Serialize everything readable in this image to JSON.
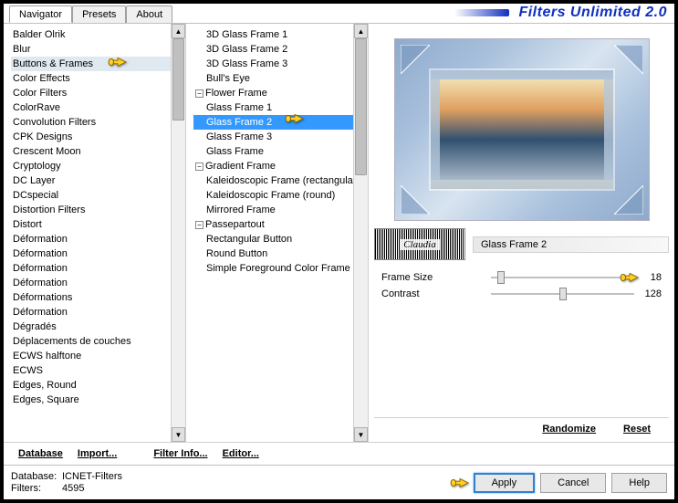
{
  "app_title": "Filters Unlimited 2.0",
  "tabs": [
    "Navigator",
    "Presets",
    "About"
  ],
  "active_tab": 0,
  "categories": [
    "Balder Olrik",
    "Blur",
    "Buttons & Frames",
    "Color Effects",
    "Color Filters",
    "ColorRave",
    "Convolution Filters",
    "CPK Designs",
    "Crescent Moon",
    "Cryptology",
    "DC Layer",
    "DCspecial",
    "Distortion Filters",
    "Distort",
    "Déformation",
    "Déformation",
    "Déformation",
    "Déformation",
    "Déformations",
    "Déformation",
    "Dégradés",
    "Déplacements de couches",
    "ECWS halftone",
    "ECWS",
    "Edges, Round",
    "Edges, Square"
  ],
  "category_highlight_index": 2,
  "filters": [
    {
      "label": "3D Glass Frame 1",
      "exp": false
    },
    {
      "label": "3D Glass Frame 2",
      "exp": false
    },
    {
      "label": "3D Glass Frame 3",
      "exp": false
    },
    {
      "label": "Bull's Eye",
      "exp": false
    },
    {
      "label": "Flower Frame",
      "exp": true
    },
    {
      "label": "Glass Frame 1",
      "exp": false
    },
    {
      "label": "Glass Frame 2",
      "exp": false,
      "selected": true
    },
    {
      "label": "Glass Frame 3",
      "exp": false
    },
    {
      "label": "Glass Frame",
      "exp": false
    },
    {
      "label": "Gradient Frame",
      "exp": true
    },
    {
      "label": "Kaleidoscopic Frame (rectangular)",
      "exp": false
    },
    {
      "label": "Kaleidoscopic Frame (round)",
      "exp": false
    },
    {
      "label": "Mirrored Frame",
      "exp": false
    },
    {
      "label": "Passepartout",
      "exp": true
    },
    {
      "label": "Rectangular Button",
      "exp": false
    },
    {
      "label": "Round Button",
      "exp": false
    },
    {
      "label": "Simple Foreground Color Frame",
      "exp": false
    }
  ],
  "mid_buttons": {
    "database": "Database",
    "import": "Import...",
    "filter_info": "Filter Info...",
    "editor": "Editor..."
  },
  "preview": {
    "filter_name": "Glass Frame 2",
    "logo_text": "Claudia",
    "params": [
      {
        "name": "Frame Size",
        "value": 18,
        "max": 255
      },
      {
        "name": "Contrast",
        "value": 128,
        "max": 255
      }
    ],
    "randomize": "Randomize",
    "reset": "Reset"
  },
  "footer": {
    "database_label": "Database:",
    "database_value": "ICNET-Filters",
    "filters_label": "Filters:",
    "filters_value": "4595",
    "apply": "Apply",
    "cancel": "Cancel",
    "help": "Help"
  }
}
